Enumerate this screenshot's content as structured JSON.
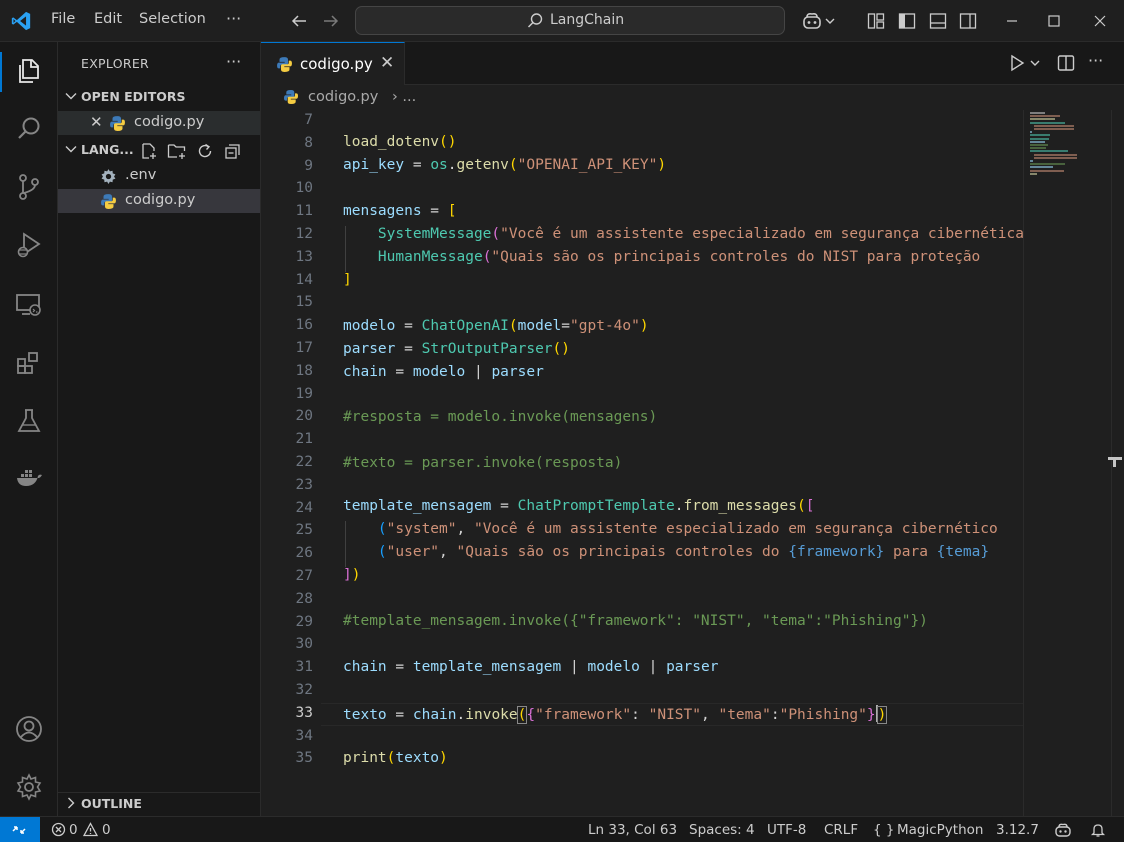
{
  "titlebar": {
    "menu": [
      "File",
      "Edit",
      "Selection"
    ],
    "more": "···",
    "search_text": "LangChain"
  },
  "sidebar": {
    "title": "EXPLORER",
    "more": "···",
    "open_editors_label": "OPEN EDITORS",
    "open_editor_file": "codigo.py",
    "close_mark": "✕",
    "folder_label": "LANG...",
    "files": [
      ".env",
      "codigo.py"
    ],
    "outline_label": "OUTLINE"
  },
  "tab": {
    "name": "codigo.py",
    "close": "✕"
  },
  "breadcrumb": {
    "file": "codigo.py",
    "sep": "› ..."
  },
  "editor": {
    "current_line": 33,
    "line_numbers": [
      "7",
      "8",
      "9",
      "10",
      "11",
      "12",
      "13",
      "14",
      "15",
      "16",
      "17",
      "18",
      "19",
      "20",
      "21",
      "22",
      "23",
      "24",
      "25",
      "26",
      "27",
      "28",
      "29",
      "30",
      "31",
      "32",
      "33",
      "34",
      "35"
    ],
    "tokens": {
      "l8_fn": "load_dotenv",
      "l8_b": "()",
      "l9_var": "api_key",
      "l9_eq": " = ",
      "l9_os": "os",
      "l9_dot": ".",
      "l9_fn": "getenv",
      "l9_o": "(",
      "l9_str": "\"OPENAI_API_KEY\"",
      "l9_c": ")",
      "l11_var": "mensagens",
      "l11_eq": " = ",
      "l11_o": "[",
      "l12_ind": "    ",
      "l12_cls": "SystemMessage",
      "l12_o": "(",
      "l12_str": "\"Você é um assistente especializado em segurança cibernética",
      "l13_ind": "    ",
      "l13_cls": "HumanMessage",
      "l13_o": "(",
      "l13_str": "\"Quais são os principais controles do NIST para proteção",
      "l14_c": "]",
      "l16_var": "modelo",
      "l16_eq": " = ",
      "l16_cls": "ChatOpenAI",
      "l16_o": "(",
      "l16_kw": "model",
      "l16_eq2": "=",
      "l16_str": "\"gpt-4o\"",
      "l16_c": ")",
      "l17_var": "parser",
      "l17_eq": " = ",
      "l17_cls": "StrOutputParser",
      "l17_b": "()",
      "l18_var": "chain",
      "l18_eq": " = ",
      "l18_v2": "modelo",
      "l18_pipe": " | ",
      "l18_v3": "parser",
      "l20_cmt": "#resposta = modelo.invoke(mensagens)",
      "l22_cmt": "#texto = parser.invoke(resposta)",
      "l24_var": "template_mensagem",
      "l24_eq": " = ",
      "l24_cls": "ChatPromptTemplate",
      "l24_dot": ".",
      "l24_fn": "from_messages",
      "l24_o1": "(",
      "l24_o2": "[",
      "l25_ind": "    ",
      "l25_o": "(",
      "l25_s1": "\"system\"",
      "l25_comma": ", ",
      "l25_s2": "\"Você é um assistente especializado em segurança cibernético",
      "l26_ind": "    ",
      "l26_o": "(",
      "l26_s1": "\"user\"",
      "l26_comma": ", ",
      "l26_s2a": "\"Quais são os principais controles do ",
      "l26_f1": "{framework}",
      "l26_s2b": " para ",
      "l26_f2": "{tema}",
      "l27_c1": "]",
      "l27_c2": ")",
      "l29_cmt": "#template_mensagem.invoke({\"framework\": \"NIST\", \"tema\":\"Phishing\"})",
      "l31_var": "chain",
      "l31_eq": " = ",
      "l31_v2": "template_mensagem",
      "l31_p1": " | ",
      "l31_v3": "modelo",
      "l31_p2": " | ",
      "l31_v4": "parser",
      "l33_var": "texto",
      "l33_eq": " = ",
      "l33_v2": "chain",
      "l33_dot": ".",
      "l33_fn": "invoke",
      "l33_o": "(",
      "l33_ob": "{",
      "l33_s1": "\"framework\"",
      "l33_colon": ": ",
      "l33_s2": "\"NIST\"",
      "l33_comma": ", ",
      "l33_s3": "\"tema\"",
      "l33_colon2": ":",
      "l33_s4": "\"Phishing\"",
      "l33_cb": "}",
      "l33_c": ")",
      "l35_fn": "print",
      "l35_o": "(",
      "l35_var": "texto",
      "l35_c": ")"
    }
  },
  "statusbar": {
    "errors": "0",
    "warnings": "0",
    "position": "Ln 33, Col 63",
    "spaces": "Spaces: 4",
    "encoding": "UTF-8",
    "eol": "CRLF",
    "lang_braces": "{ }",
    "language": "MagicPython",
    "version": "3.12.7"
  },
  "colors": {
    "accent": "#0078d4",
    "background": "#1f1f1f",
    "sidebar": "#181818"
  }
}
